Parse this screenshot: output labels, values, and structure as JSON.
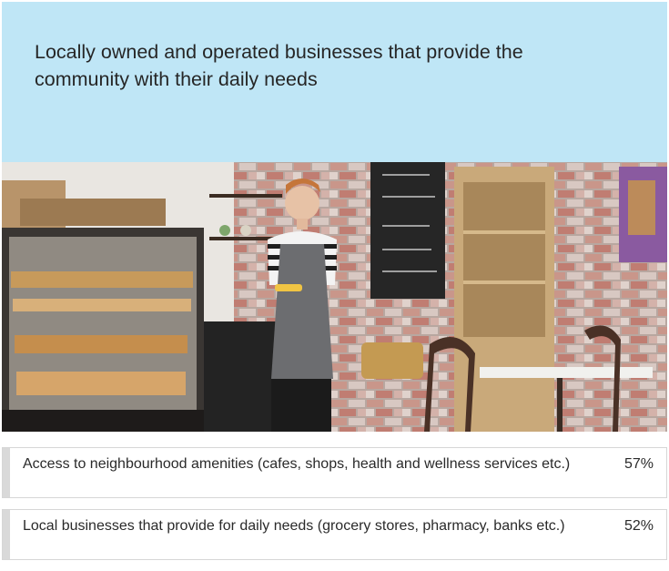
{
  "header": {
    "title": "Locally owned and operated businesses that provide the community with their daily needs"
  },
  "photo": {
    "description_icon": "cafe-owner-photo"
  },
  "stats": [
    {
      "label": "Access to neighbourhood amenities (cafes, shops, health and wellness services etc.)",
      "value": "57%"
    },
    {
      "label": "Local businesses that provide for daily needs (grocery stores, pharmacy, banks etc.)",
      "value": "52%"
    }
  ],
  "colors": {
    "header_bg": "#bfe6f6",
    "row_accent": "#d9d9d9"
  }
}
